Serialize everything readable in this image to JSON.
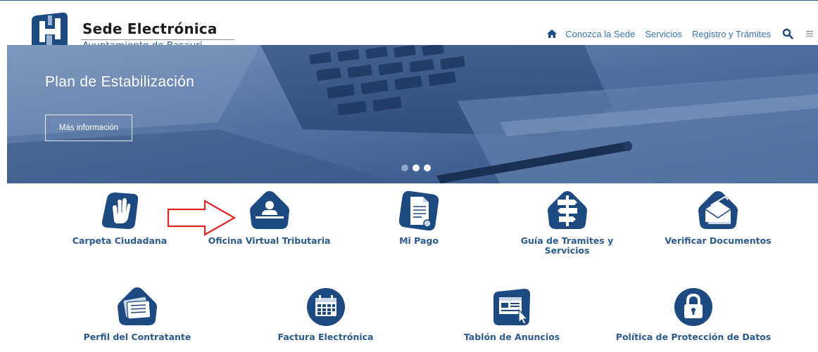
{
  "brand": {
    "title": "Sede Electrónica",
    "subtitle": "Ayuntamiento de Basauri"
  },
  "nav": {
    "home_icon": "home-icon",
    "links": [
      "Conozca la Sede",
      "Servicios",
      "Registro y Trámites"
    ],
    "search_icon": "search-icon",
    "menu_icon": "hamburger-menu-icon"
  },
  "hero": {
    "title": "Plan de Estabilización",
    "button_label": "Más información",
    "slide_count": 3,
    "active_slide": 2
  },
  "services": {
    "row1": [
      {
        "label": "Carpeta Ciudadana",
        "icon": "hand-icon"
      },
      {
        "label": "Oficina Virtual Tributaria",
        "icon": "person-desk-icon"
      },
      {
        "label": "Mi Pago",
        "icon": "document-icon"
      },
      {
        "label": "Guía de Tramites y",
        "label2": "Servicios",
        "icon": "signpost-icon"
      },
      {
        "label": "Verificar Documentos",
        "icon": "envelope-icon"
      }
    ],
    "row2": [
      {
        "label": "Perfil del Contratante",
        "icon": "stacked-cards-icon"
      },
      {
        "label": "Factura Electrónica",
        "icon": "calendar-icon"
      },
      {
        "label": "Tablón de Anuncios",
        "icon": "notice-board-icon"
      },
      {
        "label": "Política de Protección de Datos",
        "icon": "padlock-icon"
      }
    ]
  },
  "annotation": {
    "arrow_color": "#e0231f",
    "icon": "red-arrow-icon"
  },
  "colors": {
    "primary": "#1d4a80",
    "label": "#2b5a8c",
    "nav_link": "#3a75b5"
  }
}
